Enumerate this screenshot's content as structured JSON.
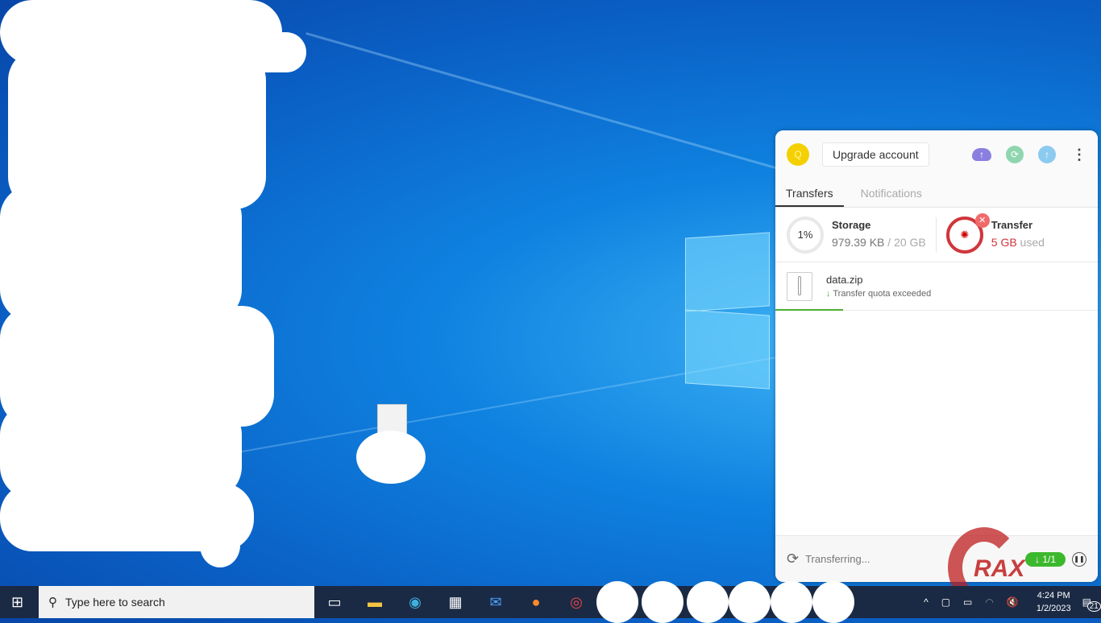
{
  "panel": {
    "avatar_initial": "Q",
    "upgrade_label": "Upgrade account",
    "tabs": [
      "Transfers",
      "Notifications"
    ],
    "storage": {
      "percent": "1%",
      "label": "Storage",
      "used": "979.39 KB",
      "separator": " / ",
      "total": "20 GB"
    },
    "transfer": {
      "label": "Transfer",
      "amount": "5 GB",
      "suffix": " used"
    },
    "file": {
      "name": "data.zip",
      "status": "Transfer quota exceeded",
      "progress_percent": 21
    },
    "footer": {
      "status": "Transferring...",
      "count": "1/1"
    }
  },
  "taskbar": {
    "search_placeholder": "Type here to search",
    "time": "4:24 PM",
    "date": "1/2/2023",
    "notifications": "21"
  },
  "watermark": "RAX",
  "colors": {
    "accent": "#4cae33",
    "danger": "#d0363c",
    "avatar": "#f5d000"
  }
}
